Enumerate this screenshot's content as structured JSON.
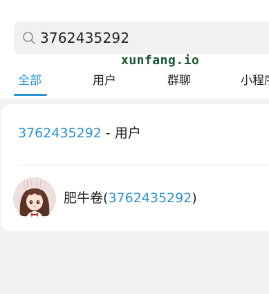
{
  "search": {
    "query": "3762435292",
    "icon": "search-icon"
  },
  "watermark": "xunfang.io",
  "tabs": [
    {
      "label": "全部",
      "active": true
    },
    {
      "label": "用户",
      "active": false
    },
    {
      "label": "群聊",
      "active": false
    },
    {
      "label": "小程序",
      "active": false
    }
  ],
  "results": {
    "header_id": "3762435292",
    "header_suffix": " - 用户",
    "user": {
      "avatar": "anime-girl-avatar",
      "name": "肥牛卷",
      "open_paren": "(",
      "id": "3762435292",
      "close_paren": ")"
    }
  },
  "colors": {
    "accent": "#2a91d2",
    "background": "#f2f2f2",
    "card": "#ffffff",
    "watermark": "#18572f"
  }
}
